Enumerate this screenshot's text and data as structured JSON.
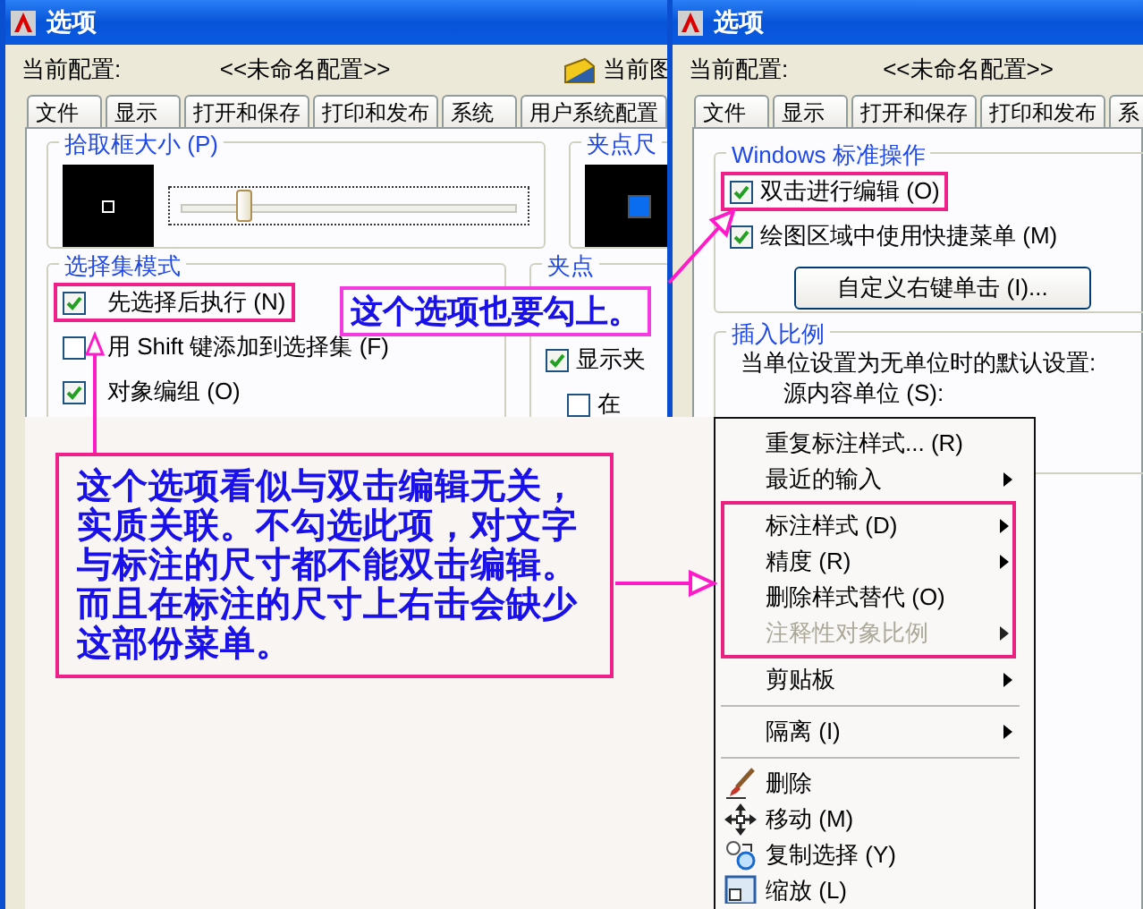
{
  "left_dialog": {
    "title": "选项",
    "profile_label": "当前配置:",
    "profile_value": "<<未命名配置>>",
    "drawing_label": "当前图",
    "tabs": [
      {
        "label": "文件",
        "selected": false
      },
      {
        "label": "显示",
        "selected": false
      },
      {
        "label": "打开和保存",
        "selected": false
      },
      {
        "label": "打印和发布",
        "selected": false
      },
      {
        "label": "系统",
        "selected": false
      },
      {
        "label": "用户系统配置",
        "selected": false
      }
    ],
    "pickbox": {
      "title": "拾取框大小 (P)",
      "level": 0.18
    },
    "grip_size": {
      "title": "夹点尺"
    },
    "selection_modes": {
      "title": "选择集模式",
      "options": [
        {
          "label": "先选择后执行 (N)",
          "checked": true,
          "highlighted": true
        },
        {
          "label": "用 Shift 键添加到选择集 (F)",
          "checked": false,
          "highlighted": false
        },
        {
          "label": "对象编组 (O)",
          "checked": true,
          "highlighted": false
        }
      ]
    },
    "grips": {
      "title": "夹点",
      "options": [
        {
          "label": "显示夹",
          "checked": true
        },
        {
          "label": "在",
          "checked": false
        }
      ]
    }
  },
  "right_dialog": {
    "title": "选项",
    "profile_label": "当前配置:",
    "profile_value": "<<未命名配置>>",
    "tabs": [
      {
        "label": "文件",
        "selected": false
      },
      {
        "label": "显示",
        "selected": false
      },
      {
        "label": "打开和保存",
        "selected": false
      },
      {
        "label": "打印和发布",
        "selected": false
      },
      {
        "label": "系",
        "selected": false
      }
    ],
    "windows_ops": {
      "title": "Windows 标准操作",
      "options": [
        {
          "label": "双击进行编辑 (O)",
          "checked": true,
          "highlighted": true
        },
        {
          "label": "绘图区域中使用快捷菜单 (M)",
          "checked": true,
          "highlighted": false
        }
      ],
      "button": "自定义右键单击 (I)..."
    },
    "insert_scale": {
      "title": "插入比例",
      "note": "当单位设置为无单位时的默认设置:",
      "field_label": "源内容单位 (S):"
    }
  },
  "annotations": {
    "small": "这个选项也要勾上。",
    "large": "这个选项看似与双击编辑无关，实质关联。不勾选此项，对文字与标注的尺寸都不能双击编辑。而且在标注的尺寸上右击会缺少这部份菜单。"
  },
  "context_menu": {
    "sections": [
      {
        "highlighted": false,
        "separated": false,
        "items": [
          {
            "label": "重复标注样式... (R)",
            "submenu": false,
            "disabled": false
          },
          {
            "label": "最近的输入",
            "submenu": true,
            "disabled": false
          }
        ]
      },
      {
        "highlighted": true,
        "separated": false,
        "items": [
          {
            "label": "标注样式 (D)",
            "submenu": true,
            "disabled": false
          },
          {
            "label": "精度 (R)",
            "submenu": true,
            "disabled": false
          },
          {
            "label": "删除样式替代 (O)",
            "submenu": false,
            "disabled": false
          },
          {
            "label": "注释性对象比例",
            "submenu": true,
            "disabled": true
          }
        ]
      },
      {
        "highlighted": false,
        "separated": false,
        "items": [
          {
            "label": "剪贴板",
            "submenu": true,
            "disabled": false
          }
        ]
      },
      {
        "highlighted": false,
        "separated": true,
        "items": [
          {
            "label": "隔离 (I)",
            "submenu": true,
            "disabled": false
          }
        ]
      },
      {
        "highlighted": false,
        "separated": true,
        "kind": "tools",
        "items": [
          {
            "label": "删除",
            "submenu": false,
            "disabled": false
          },
          {
            "label": "移动 (M)",
            "submenu": false,
            "disabled": false
          },
          {
            "label": "复制选择 (Y)",
            "submenu": false,
            "disabled": false
          },
          {
            "label": "缩放 (L)",
            "submenu": false,
            "disabled": false
          }
        ]
      }
    ]
  }
}
